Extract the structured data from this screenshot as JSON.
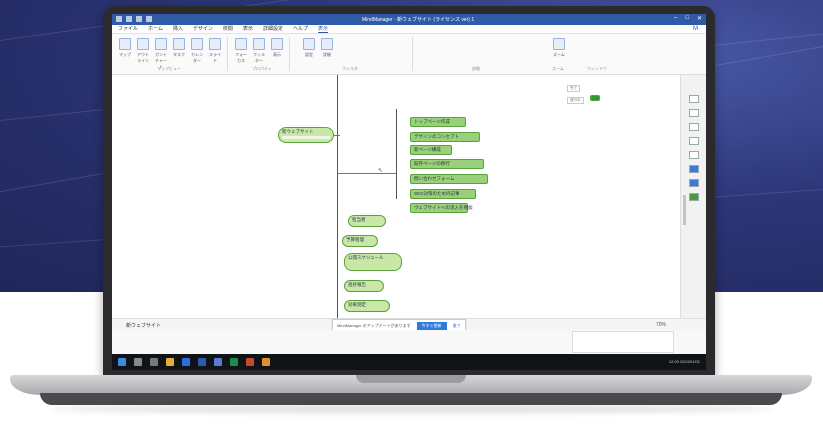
{
  "app": {
    "title": "MindManager - 新ウェブサイト (ライセンス ver) 1",
    "window_controls": [
      "–",
      "□",
      "✕"
    ],
    "help_label": "M·",
    "menu_tabs": [
      "ファイル",
      "ホーム",
      "挿入",
      "デザイン",
      "校閲",
      "表示",
      "詳細設定",
      "ヘルプ",
      "表示"
    ],
    "active_tab_index": 8,
    "ribbon_buttons": [
      "マップ",
      "アウトライン",
      "ガントチャート",
      "タスク",
      "カレンダー",
      "スライド",
      "フォーカス",
      "フィルター",
      "表示",
      "設定",
      "詳細",
      "ズーム"
    ],
    "ribbon_groups": [
      "マップビュー",
      "プロパティ",
      "フィルタ",
      "詳細",
      "ズーム",
      "ウィンドウ"
    ]
  },
  "map": {
    "central_topic": "新ウェブサイト",
    "topics": [
      "トップページ作成",
      "デザインのコンセプト",
      "新ページ構成",
      "既存ページの移行",
      "問い合わせフォーム",
      "SEO対策のための記事",
      "ウェブサイトへの流入を増加",
      "担当者",
      "予算管理",
      "公開スケジュール",
      "進捗報告",
      "効果測定"
    ],
    "top_right_items": [
      "完了",
      "進行中"
    ]
  },
  "status": {
    "map_tab": "新ウェブサイト",
    "toast_text": "MindManager のアップデートがあります",
    "toast_button": "今すぐ更新",
    "toast_close": "後で",
    "zoom": "70%"
  },
  "taskbar": {
    "tray": "12:00 2024/01/01"
  },
  "colors": {
    "title_bar": "#2f5aa8",
    "topic_fill": "#9bd07a",
    "topic_border": "#5aa23c",
    "background": "#2c3577",
    "taskbar": "#101318"
  }
}
